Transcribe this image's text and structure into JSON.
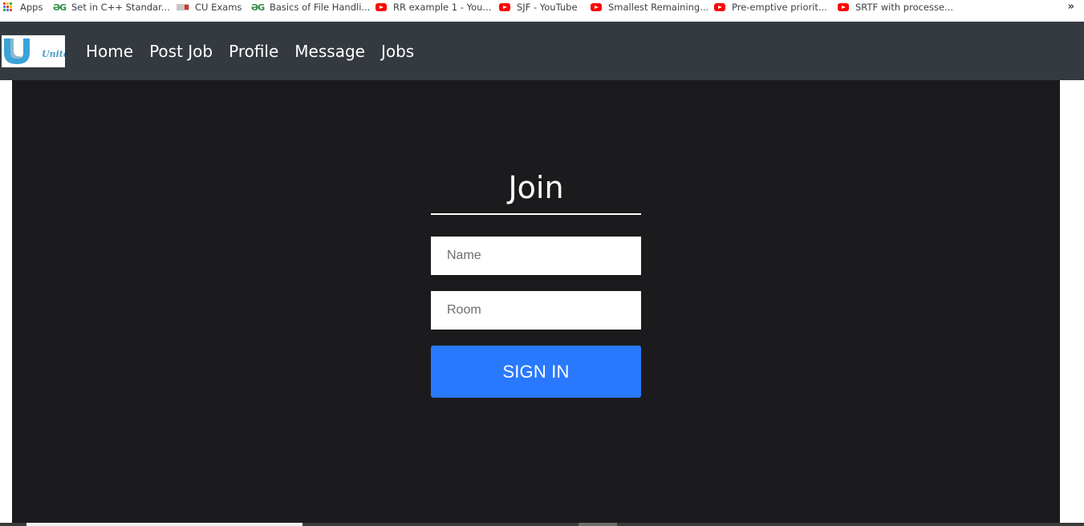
{
  "bookmarks": {
    "items": [
      {
        "label": "Apps",
        "icon": "apps-grid-icon"
      },
      {
        "label": "Set in C++ Standar...",
        "icon": "geeksforgeeks-icon"
      },
      {
        "label": "CU Exams",
        "icon": "cu-icon"
      },
      {
        "label": "Basics of File Handli...",
        "icon": "geeksforgeeks-icon"
      },
      {
        "label": "RR example 1 - You...",
        "icon": "youtube-icon"
      },
      {
        "label": "SJF - YouTube",
        "icon": "youtube-icon"
      },
      {
        "label": "Smallest Remaining...",
        "icon": "youtube-icon"
      },
      {
        "label": "Pre-emptive priorit...",
        "icon": "youtube-icon"
      },
      {
        "label": "SRTF with processe...",
        "icon": "youtube-icon"
      }
    ],
    "overflow": "»"
  },
  "navbar": {
    "brand": "Unite",
    "links": [
      "Home",
      "Post Job",
      "Profile",
      "Message",
      "Jobs"
    ],
    "background": "#343a40"
  },
  "join": {
    "title": "Join",
    "name_placeholder": "Name",
    "name_value": "",
    "room_placeholder": "Room",
    "room_value": "",
    "submit_label": "SIGN IN",
    "button_color": "#2979ff"
  },
  "colors": {
    "main_background": "#1b1b1d",
    "youtube_red": "#ff0000",
    "gfg_green": "#2f8d46"
  }
}
